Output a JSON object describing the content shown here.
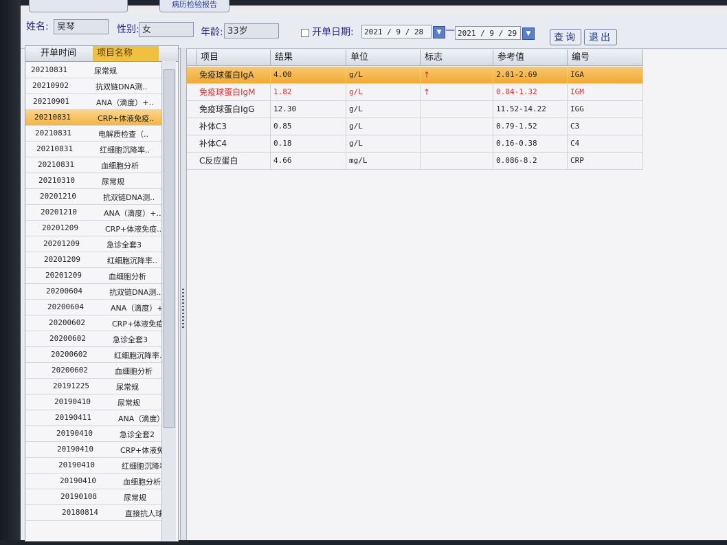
{
  "top_tabs": [
    {
      "label": ""
    },
    {
      "label": "病历检验报告"
    }
  ],
  "patient": {
    "name_label": "姓名:",
    "name_value": "吴琴",
    "sex_label": "性别:",
    "sex_value": "女",
    "age_label": "年龄:",
    "age_value": "33岁"
  },
  "filter": {
    "checkbox_label": "开单日期:",
    "date_from": "2021 / 9 / 28",
    "date_sep": "—",
    "date_to": "2021 / 9 / 29",
    "query_button": "查询",
    "exit_button": "退出"
  },
  "order_list": {
    "headers": [
      "开单时间",
      "项目名称"
    ],
    "rows": [
      {
        "date": "20210831",
        "name": "尿常规"
      },
      {
        "date": "20210902",
        "name": "抗双链DNA测.."
      },
      {
        "date": "20210901",
        "name": "ANA（滴度）+.."
      },
      {
        "date": "20210831",
        "name": "CRP+体液免疫.."
      },
      {
        "date": "20210831",
        "name": "电解质检查（.."
      },
      {
        "date": "20210831",
        "name": "红细胞沉降率.."
      },
      {
        "date": "20210831",
        "name": "血细胞分析"
      },
      {
        "date": "20210310",
        "name": "尿常规"
      },
      {
        "date": "20201210",
        "name": "抗双链DNA测.."
      },
      {
        "date": "20201210",
        "name": "ANA（滴度）+.."
      },
      {
        "date": "20201209",
        "name": "CRP+体液免疫.."
      },
      {
        "date": "20201209",
        "name": "急诊全套3"
      },
      {
        "date": "20201209",
        "name": "红细胞沉降率.."
      },
      {
        "date": "20201209",
        "name": "血细胞分析"
      },
      {
        "date": "20200604",
        "name": "抗双链DNA测.."
      },
      {
        "date": "20200604",
        "name": "ANA（滴度）+.."
      },
      {
        "date": "20200602",
        "name": "CRP+体液免疫.."
      },
      {
        "date": "20200602",
        "name": "急诊全套3"
      },
      {
        "date": "20200602",
        "name": "红细胞沉降率.."
      },
      {
        "date": "20200602",
        "name": "血细胞分析"
      },
      {
        "date": "20191225",
        "name": "尿常规"
      },
      {
        "date": "20190410",
        "name": "尿常规"
      },
      {
        "date": "20190411",
        "name": "ANA（滴度）+.."
      },
      {
        "date": "20190410",
        "name": "急诊全套2"
      },
      {
        "date": "20190410",
        "name": "CRP+体液免疫.."
      },
      {
        "date": "20190410",
        "name": "红细胞沉降率.."
      },
      {
        "date": "20190410",
        "name": "血细胞分析"
      },
      {
        "date": "20190108",
        "name": "尿常规"
      },
      {
        "date": "20180814",
        "name": "直接抗人球蛋.."
      }
    ],
    "selected_index": 3
  },
  "results": {
    "headers": [
      "项目",
      "结果",
      "单位",
      "标志",
      "参考值",
      "编号"
    ],
    "rows": [
      {
        "item": "免疫球蛋白IgA",
        "result": "4.00",
        "unit": "g/L",
        "flag": "↑",
        "ref": "2.01-2.69",
        "code": "IGA"
      },
      {
        "item": "免疫球蛋白IgM",
        "result": "1.82",
        "unit": "g/L",
        "flag": "↑",
        "ref": "0.84-1.32",
        "code": "IGM"
      },
      {
        "item": "免疫球蛋白IgG",
        "result": "12.30",
        "unit": "g/L",
        "flag": "",
        "ref": "11.52-14.22",
        "code": "IGG"
      },
      {
        "item": "补体C3",
        "result": "0.85",
        "unit": "g/L",
        "flag": "",
        "ref": "0.79-1.52",
        "code": "C3"
      },
      {
        "item": "补体C4",
        "result": "0.18",
        "unit": "g/L",
        "flag": "",
        "ref": "0.16-0.38",
        "code": "C4"
      },
      {
        "item": "C反应蛋白",
        "result": "4.66",
        "unit": "mg/L",
        "flag": "",
        "ref": "0.086-8.2",
        "code": "CRP"
      }
    ],
    "selected_index": 0,
    "highlight_index": 1
  },
  "colors": {
    "selection": "#f3b545",
    "abnormal": "#e03030",
    "accent": "#2a2a8a"
  }
}
